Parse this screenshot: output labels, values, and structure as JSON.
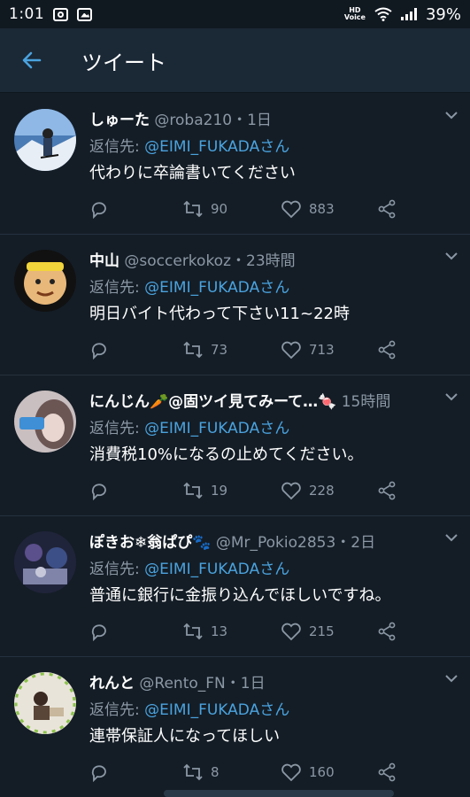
{
  "status_bar": {
    "time": "1:01",
    "hd_top": "HD",
    "hd_bottom": "Voice",
    "battery": "39%"
  },
  "header": {
    "title": "ツイート"
  },
  "reply_prefix": "返信先: ",
  "tweets": [
    {
      "name": "しゅーた",
      "handle": "@roba210",
      "time": "・1日",
      "mention": "@EIMI_FUKADAさん",
      "text": "代わりに卒論書いてください",
      "retweets": "90",
      "likes": "883"
    },
    {
      "name": "中山",
      "handle": "@soccerkokoz",
      "time": "・23時間",
      "mention": "@EIMI_FUKADAさん",
      "text": "明日バイト代わって下さい11~22時",
      "retweets": "73",
      "likes": "713"
    },
    {
      "name": "にんじん🥕@固ツイ見てみーて…🍬",
      "handle": "",
      "time": "15時間",
      "mention": "@EIMI_FUKADAさん",
      "text": "消費税10%になるの止めてください。",
      "retweets": "19",
      "likes": "228"
    },
    {
      "name": "ぽきお❄翁ぱぴ🐾",
      "handle": "@Mr_Pokio2853",
      "time": "・2日",
      "mention": "@EIMI_FUKADAさん",
      "text": "普通に銀行に金振り込んでほしいですね。",
      "retweets": "13",
      "likes": "215"
    },
    {
      "name": "れんと",
      "handle": "@Rento_FN",
      "time": "・1日",
      "mention": "@EIMI_FUKADAさん",
      "text": "連帯保証人になってほしい",
      "retweets": "8",
      "likes": "160"
    }
  ],
  "colors": {
    "background": "#141d26",
    "header": "#1b2836",
    "link": "#4aa3df",
    "muted": "#8b98a5"
  }
}
